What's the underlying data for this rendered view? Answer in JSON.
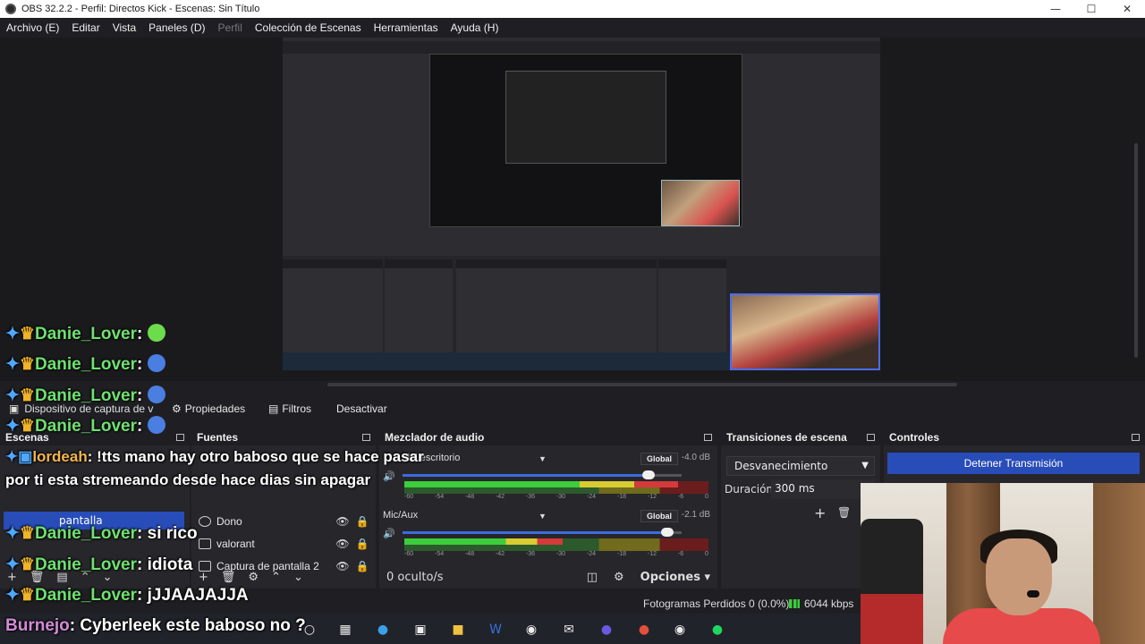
{
  "window": {
    "title": "OBS 32.2.2 - Perfil: Directos Kick - Escenas: Sin Título",
    "controls": [
      "—",
      "☐",
      "✕"
    ]
  },
  "menu": [
    {
      "label": "Archivo (E)",
      "enabled": true
    },
    {
      "label": "Editar",
      "enabled": true
    },
    {
      "label": "Vista",
      "enabled": true
    },
    {
      "label": "Paneles (D)",
      "enabled": true
    },
    {
      "label": "Perfil",
      "enabled": false
    },
    {
      "label": "Colección de Escenas",
      "enabled": true
    },
    {
      "label": "Herramientas",
      "enabled": true
    },
    {
      "label": "Ayuda (H)",
      "enabled": true
    }
  ],
  "source_toolbar": {
    "source_name": "Dispositivo de captura de v",
    "properties": "Propiedades",
    "filters": "Filtros",
    "deactivate": "Desactivar"
  },
  "scenes": {
    "title": "Escenas",
    "selected": "pantalla"
  },
  "sources": {
    "title": "Fuentes",
    "items": [
      {
        "name": "Dono",
        "icon": "globe-icon"
      },
      {
        "name": "valorant",
        "icon": "window-icon"
      },
      {
        "name": "Captura de pantalla 2",
        "icon": "monitor-icon"
      }
    ]
  },
  "mixer": {
    "title": "Mezclador de audio",
    "tracks": [
      {
        "name": "del escritorio",
        "badge": "Global",
        "db": "-4.0 dB",
        "volume": 0.88,
        "level": 0.9
      },
      {
        "name": "Mic/Aux",
        "badge": "Global",
        "db": "-2.1 dB",
        "volume": 0.95,
        "level": 0.52
      }
    ],
    "ticks": [
      "-60",
      "-54",
      "-48",
      "-42",
      "-36",
      "-30",
      "-24",
      "-18",
      "-12",
      "-6",
      "0"
    ],
    "hidden": "0 oculto/s",
    "options": "Opciones"
  },
  "transitions": {
    "title": "Transiciones de escena",
    "selected": "Desvanecimiento",
    "duration_label": "Duración",
    "duration_value": "300 ms"
  },
  "controls": {
    "title": "Controles",
    "stream_button": "Detener Transmisión"
  },
  "status": {
    "dropped": "Fotogramas Perdidos 0 (0.0%)",
    "kbps": "6044 kbps"
  },
  "chat": [
    {
      "user": "Danie_Lover",
      "text": "",
      "emote_color": "#6ddc4c"
    },
    {
      "user": "Danie_Lover",
      "text": "",
      "emote_color": "#4a7ee0"
    },
    {
      "user": "Danie_Lover",
      "text": "",
      "emote_color": "#4a7ee0"
    },
    {
      "user": "Danie_Lover",
      "text": "",
      "emote_color": "#4a7ee0"
    },
    {
      "user": "lordeah",
      "text": "!tts mano hay otro baboso que se hace pasar por ti esta stremeando desde hace dias sin apagar"
    },
    {
      "user": "Danie_Lover",
      "text": "si rico"
    },
    {
      "user": "Danie_Lover",
      "text": "idiota"
    },
    {
      "user": "Danie_Lover",
      "text": "jJJAAJAJJA"
    },
    {
      "user": "Burnejo",
      "text": "Cyberleek este baboso no ?"
    }
  ],
  "colors": {
    "accent": "#284cb8",
    "background": "#1f1e22",
    "chat_user": "#6ee26e"
  }
}
